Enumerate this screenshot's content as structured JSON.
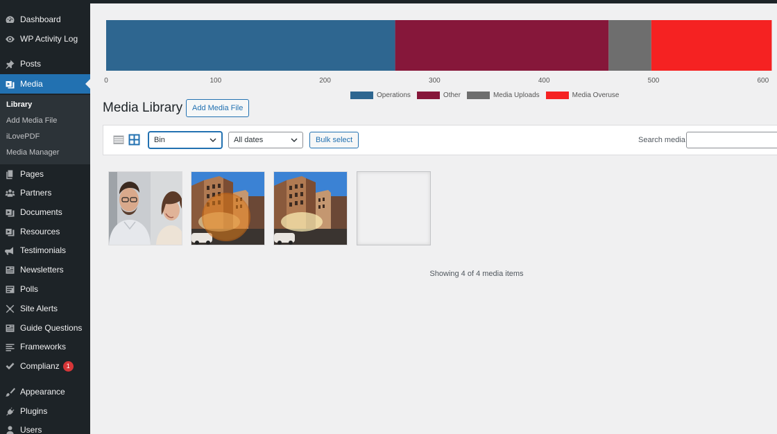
{
  "sidebar": {
    "items": [
      {
        "label": "Dashboard",
        "icon": "dashboard-icon"
      },
      {
        "label": "WP Activity Log",
        "icon": "activity-log-icon"
      },
      {
        "label": "Posts",
        "icon": "pin-icon"
      },
      {
        "label": "Media",
        "icon": "media-icon",
        "active": true
      },
      {
        "label": "Pages",
        "icon": "pages-icon"
      },
      {
        "label": "Partners",
        "icon": "partners-icon"
      },
      {
        "label": "Documents",
        "icon": "documents-icon"
      },
      {
        "label": "Resources",
        "icon": "resources-icon"
      },
      {
        "label": "Testimonials",
        "icon": "megaphone-icon"
      },
      {
        "label": "Newsletters",
        "icon": "newsletter-icon"
      },
      {
        "label": "Polls",
        "icon": "polls-icon"
      },
      {
        "label": "Site Alerts",
        "icon": "alerts-icon"
      },
      {
        "label": "Guide Questions",
        "icon": "guide-icon"
      },
      {
        "label": "Frameworks",
        "icon": "frameworks-icon"
      },
      {
        "label": "Complianz",
        "icon": "check-icon",
        "badge": "1"
      },
      {
        "label": "Appearance",
        "icon": "brush-icon"
      },
      {
        "label": "Plugins",
        "icon": "plug-icon"
      },
      {
        "label": "Users",
        "icon": "users-icon"
      }
    ],
    "submenu": [
      {
        "label": "Library",
        "current": true
      },
      {
        "label": "Add Media File"
      },
      {
        "label": "iLovePDF"
      },
      {
        "label": "Media Manager"
      }
    ]
  },
  "chart_data": {
    "type": "bar",
    "orientation": "horizontal-stacked",
    "categories": [
      ""
    ],
    "series": [
      {
        "name": "Operations",
        "values": [
          264
        ],
        "color": "#2e6690"
      },
      {
        "name": "Other",
        "values": [
          195
        ],
        "color": "#86173a"
      },
      {
        "name": "Media Uploads",
        "values": [
          39
        ],
        "color": "#6e6e6e"
      },
      {
        "name": "Media Overuse",
        "values": [
          110
        ],
        "color": "#f52222"
      }
    ],
    "xticks": [
      0,
      100,
      200,
      300,
      400,
      500,
      600
    ],
    "xlim": [
      0,
      610
    ],
    "grid": false,
    "legend": "bottom",
    "title": "",
    "xlabel": "",
    "ylabel": ""
  },
  "main": {
    "title": "Media Library",
    "add_button": "Add Media File",
    "filter_type": "Bin",
    "filter_dates": "All dates",
    "bulk_select": "Bulk select",
    "search_label": "Search media",
    "search_value": "",
    "count_text": "Showing 4 of 4 media items"
  },
  "colors": {
    "sidebar_bg": "#1d2327",
    "accent": "#2271b1",
    "badge": "#d63638"
  }
}
